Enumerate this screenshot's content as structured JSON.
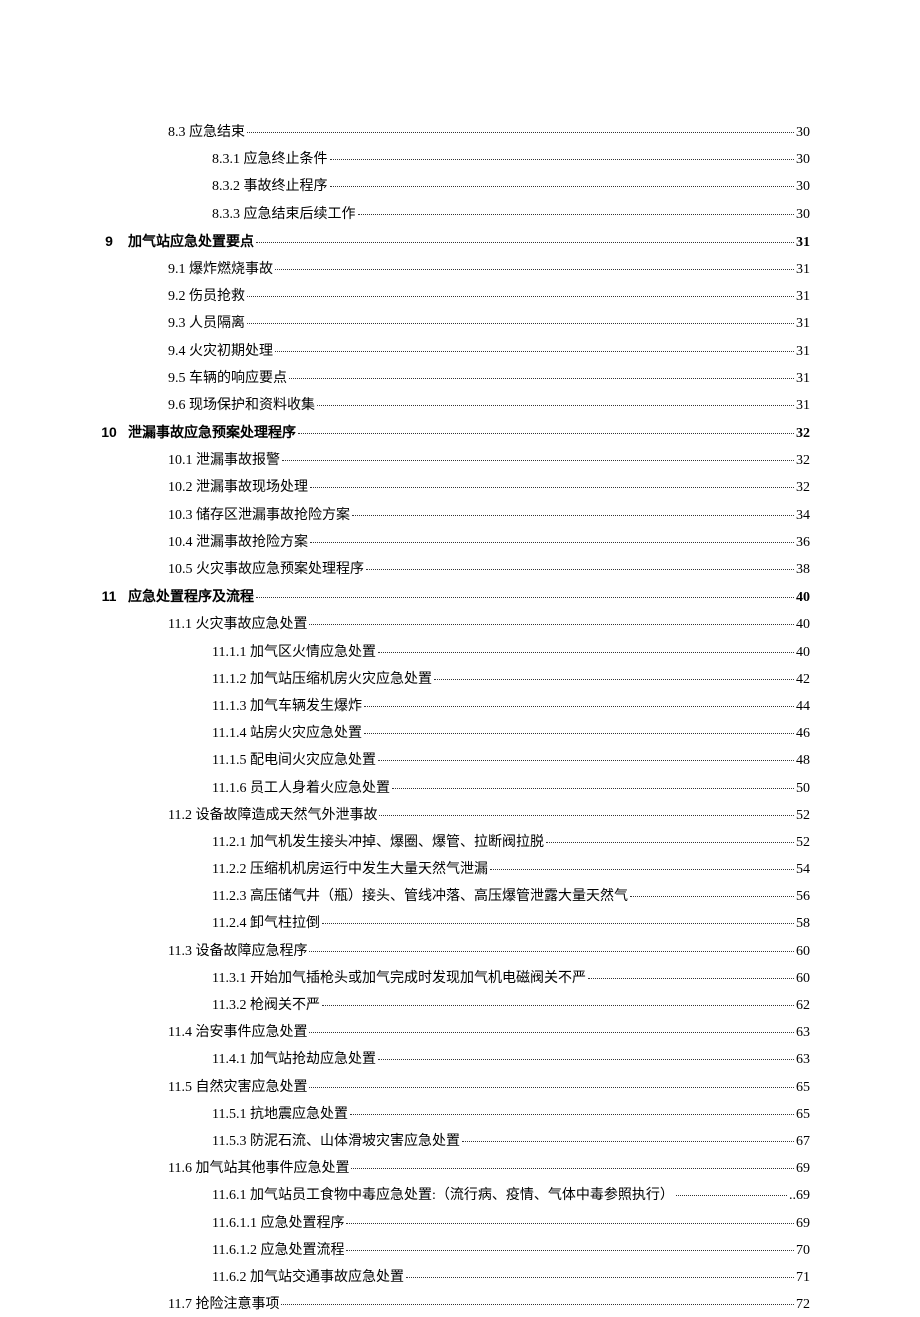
{
  "toc": [
    {
      "level": 2,
      "text": "8.3 应急结束",
      "page": "30"
    },
    {
      "level": 3,
      "text": "8.3.1 应急终止条件",
      "page": "30"
    },
    {
      "level": 3,
      "text": "8.3.2 事故终止程序",
      "page": "30"
    },
    {
      "level": 3,
      "text": "8.3.3 应急结束后续工作",
      "page": "30"
    },
    {
      "level": 1,
      "num": "9",
      "text": "加气站应急处置要点",
      "page": "31"
    },
    {
      "level": 2,
      "text": "9.1 爆炸燃烧事故",
      "page": "31"
    },
    {
      "level": 2,
      "text": "9.2 伤员抢救",
      "page": "31"
    },
    {
      "level": 2,
      "text": "9.3 人员隔离",
      "page": "31"
    },
    {
      "level": 2,
      "text": "9.4 火灾初期处理",
      "page": "31"
    },
    {
      "level": 2,
      "text": "9.5 车辆的响应要点",
      "page": "31"
    },
    {
      "level": 2,
      "text": "9.6 现场保护和资料收集",
      "page": "31"
    },
    {
      "level": 1,
      "num": "10",
      "text": "泄漏事故应急预案处理程序",
      "page": "32"
    },
    {
      "level": 2,
      "text": "10.1 泄漏事故报警",
      "page": "32"
    },
    {
      "level": 2,
      "text": "10.2 泄漏事故现场处理",
      "page": "32"
    },
    {
      "level": 2,
      "text": "10.3 储存区泄漏事故抢险方案",
      "page": "34"
    },
    {
      "level": 2,
      "text": "10.4 泄漏事故抢险方案",
      "page": "36"
    },
    {
      "level": 2,
      "text": "10.5 火灾事故应急预案处理程序",
      "page": "38"
    },
    {
      "level": 1,
      "num": "11",
      "text": "应急处置程序及流程",
      "page": "40"
    },
    {
      "level": 2,
      "text": "11.1 火灾事故应急处置",
      "page": "40"
    },
    {
      "level": 3,
      "text": "11.1.1 加气区火情应急处置",
      "page": "40"
    },
    {
      "level": 3,
      "text": "11.1.2 加气站压缩机房火灾应急处置",
      "page": "42"
    },
    {
      "level": 3,
      "text": "11.1.3 加气车辆发生爆炸",
      "page": "44"
    },
    {
      "level": 3,
      "text": "11.1.4 站房火灾应急处置",
      "page": "46"
    },
    {
      "level": 3,
      "text": "11.1.5 配电间火灾应急处置",
      "page": "48"
    },
    {
      "level": 3,
      "text": "11.1.6 员工人身着火应急处置",
      "page": "50"
    },
    {
      "level": 2,
      "text": "11.2 设备故障造成天然气外泄事故",
      "page": "52"
    },
    {
      "level": 3,
      "text": "11.2.1 加气机发生接头冲掉、爆圈、爆管、拉断阀拉脱",
      "page": "52"
    },
    {
      "level": 3,
      "text": "11.2.2 压缩机机房运行中发生大量天然气泄漏",
      "page": "54"
    },
    {
      "level": 3,
      "text": "11.2.3 高压储气井（瓶）接头、管线冲落、高压爆管泄露大量天然气",
      "page": "56"
    },
    {
      "level": 3,
      "text": "11.2.4 卸气柱拉倒",
      "page": "58"
    },
    {
      "level": 2,
      "text": "11.3 设备故障应急程序",
      "page": "60"
    },
    {
      "level": 3,
      "text": "11.3.1 开始加气插枪头或加气完成时发现加气机电磁阀关不严",
      "page": "60"
    },
    {
      "level": 3,
      "text": "11.3.2 枪阀关不严",
      "page": "62"
    },
    {
      "level": 2,
      "text": "11.4 治安事件应急处置",
      "page": "63"
    },
    {
      "level": 3,
      "text": "11.4.1 加气站抢劫应急处置",
      "page": "63"
    },
    {
      "level": 2,
      "text": "11.5 自然灾害应急处置",
      "page": "65"
    },
    {
      "level": 3,
      "text": "11.5.1 抗地震应急处置",
      "page": "65"
    },
    {
      "level": 3,
      "text": "11.5.3 防泥石流、山体滑坡灾害应急处置",
      "page": "67"
    },
    {
      "level": 2,
      "text": "11.6 加气站其他事件应急处置",
      "page": "69"
    },
    {
      "level": 3,
      "text": "11.6.1 加气站员工食物中毒应急处置:（流行病、疫情、气体中毒参照执行）",
      "page": "69"
    },
    {
      "level": 4,
      "text": "11.6.1.1 应急处置程序",
      "page": "69"
    },
    {
      "level": 4,
      "text": "11.6.1.2 应急处置流程",
      "page": "70"
    },
    {
      "level": 3,
      "text": "11.6.2 加气站交通事故应急处置",
      "page": "71"
    },
    {
      "level": 2,
      "text": "11.7 抢险注意事项",
      "page": "72"
    }
  ]
}
